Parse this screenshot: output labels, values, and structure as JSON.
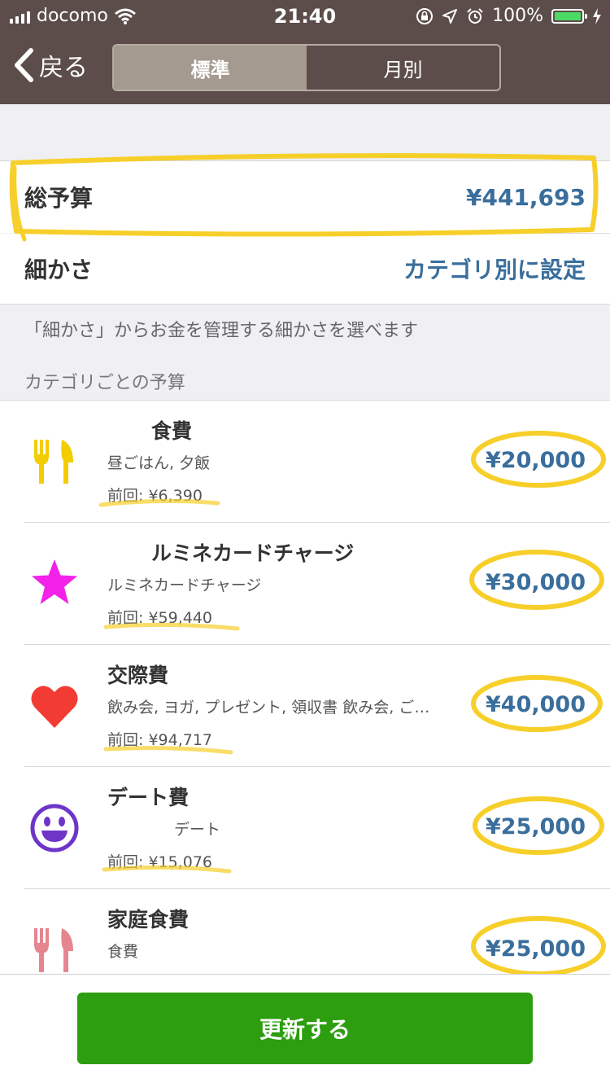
{
  "status_bar": {
    "carrier": "docomo",
    "time": "21:40",
    "battery": "100%"
  },
  "nav": {
    "back_label": "戻る",
    "tabs": [
      {
        "label": "標準",
        "active": true
      },
      {
        "label": "月別",
        "active": false
      }
    ]
  },
  "summary": {
    "total_label": "総予算",
    "total_value": "¥441,693",
    "granularity_label": "細かさ",
    "granularity_value": "カテゴリ別に設定",
    "note": "「細かさ」からお金を管理する細かさを選べます",
    "section_title": "カテゴリごとの予算"
  },
  "categories": [
    {
      "name": "食費",
      "sub": "昼ごはん, 夕飯",
      "prev": "前回: ¥6,390",
      "amount": "¥20,000",
      "icon": "fork-knife-icon",
      "color": "#f2cd00"
    },
    {
      "name": "ルミネカードチャージ",
      "sub": "ルミネカードチャージ",
      "prev": "前回: ¥59,440",
      "amount": "¥30,000",
      "icon": "star-icon",
      "color": "#f222e8"
    },
    {
      "name": "交際費",
      "sub": "飲み会, ヨガ, プレゼント, 領収書 飲み会, ご…",
      "prev": "前回: ¥94,717",
      "amount": "¥40,000",
      "icon": "heart-icon",
      "color": "#f23b33"
    },
    {
      "name": "デート費",
      "sub": "デート",
      "prev": "前回: ¥15,076",
      "amount": "¥25,000",
      "icon": "smiley-icon",
      "color": "#6e35c9"
    },
    {
      "name": "家庭食費",
      "sub": "食費",
      "prev": "",
      "amount": "¥25,000",
      "icon": "fork-knife-icon",
      "color": "#e58590"
    }
  ],
  "footer": {
    "update_label": "更新する"
  },
  "colors": {
    "nav_bg": "#5c4d4a",
    "accent_blue": "#3a6e9c",
    "primary_green": "#2d9e0f",
    "annotation_yellow": "#f7cf2a"
  }
}
